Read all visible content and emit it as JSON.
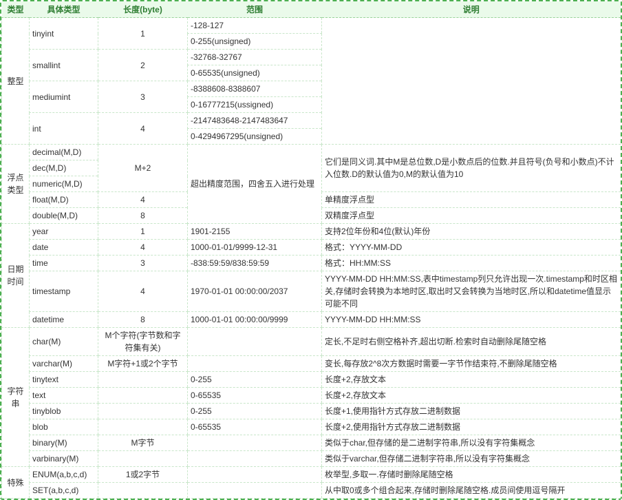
{
  "headers": {
    "type": "类型",
    "subtype": "具体类型",
    "length": "长度(byte)",
    "range": "范围",
    "desc": "说明"
  },
  "cat": {
    "int": "整型",
    "float": "浮点类型",
    "date": "日期时间",
    "str": "字符串",
    "spec": "特殊"
  },
  "int": {
    "tinyint": {
      "name": "tinyint",
      "len": "1",
      "r1": "-128-127",
      "r2": "0-255(unsigned)"
    },
    "smallint": {
      "name": "smallint",
      "len": "2",
      "r1": "-32768-32767",
      "r2": "0-65535(unsigned)"
    },
    "mediumint": {
      "name": "mediumint",
      "len": "3",
      "r1": "-8388608-8388607",
      "r2": "0-16777215(ussigned)"
    },
    "intt": {
      "name": "int",
      "len": "4",
      "r1": "-2147483648-2147483647",
      "r2": "0-4294967295(unsigned)"
    }
  },
  "float": {
    "decimal": {
      "name": "decimal(M,D)"
    },
    "dec": {
      "name": "dec(M,D)"
    },
    "numeric": {
      "name": "numeric(M,D)"
    },
    "len_mdn": "M+2",
    "range_mdn": "超出精度范围，四舍五入进行处理",
    "desc_mdn": "它们是同义词.其中M是总位数,D是小数点后的位数.并且符号(负号和小数点)不计入位数.D的默认值为0,M的默认值为10",
    "floatt": {
      "name": "float(M,D)",
      "len": "4",
      "desc": "单精度浮点型"
    },
    "doublee": {
      "name": "double(M,D)",
      "len": "8",
      "desc": "双精度浮点型"
    }
  },
  "date": {
    "year": {
      "name": "year",
      "len": "1",
      "range": "1901-2155",
      "desc": "支持2位年份和4位(默认)年份"
    },
    "datee": {
      "name": "date",
      "len": "4",
      "range": "1000-01-01/9999-12-31",
      "desc": "格式：YYYY-MM-DD"
    },
    "time": {
      "name": "time",
      "len": "3",
      "range": "-838:59:59/838:59:59",
      "desc": "格式：HH:MM:SS"
    },
    "timestamp": {
      "name": "timestamp",
      "len": "4",
      "range": "1970-01-01 00:00:00/2037",
      "desc": "YYYY-MM-DD HH:MM:SS,表中timestamp列只允许出现一次.timestamp和时区相关,存储时会转换为本地时区,取出时又会转换为当地时区,所以和datetime值显示可能不同"
    },
    "datetime": {
      "name": "datetime",
      "len": "8",
      "range": "1000-01-01 00:00:00/9999",
      "desc": "YYYY-MM-DD HH:MM:SS"
    }
  },
  "str": {
    "charr": {
      "name": "char(M)",
      "len": "M个字符(字节数和字符集有关)",
      "desc": "定长,不足时右侧空格补齐,超出切断.检索时自动删除尾随空格"
    },
    "varchar": {
      "name": "varchar(M)",
      "len": "M字符+1或2个字节",
      "desc": "变长,每存放2^8次方数据时需要一字节作结束符,不删除尾随空格"
    },
    "tinytext": {
      "name": "tinytext",
      "range": "0-255",
      "desc": "长度+2,存放文本"
    },
    "text": {
      "name": "text",
      "range": "0-65535",
      "desc": "长度+2,存放文本"
    },
    "tinyblob": {
      "name": "tinyblob",
      "range": "0-255",
      "desc": "长度+1,使用指针方式存放二进制数据"
    },
    "blob": {
      "name": "blob",
      "range": "0-65535",
      "desc": "长度+2,使用指针方式存放二进制数据"
    },
    "binary": {
      "name": "binary(M)",
      "len": "M字节",
      "desc": "类似于char,但存储的是二进制字符串,所以没有字符集概念"
    },
    "varbinary": {
      "name": "varbinary(M)",
      "desc": "类似于varchar,但存储二进制字符串,所以没有字符集概念"
    }
  },
  "spec": {
    "enumm": {
      "name": "ENUM(a,b,c,d)",
      "len": "1或2字节",
      "desc": "枚举型,多取一.存储时删除尾随空格"
    },
    "sett": {
      "name": "SET(a,b,c,d)",
      "desc": "从中取0或多个组合起来,存储时删除尾随空格.成员间使用逗号隔开"
    }
  }
}
